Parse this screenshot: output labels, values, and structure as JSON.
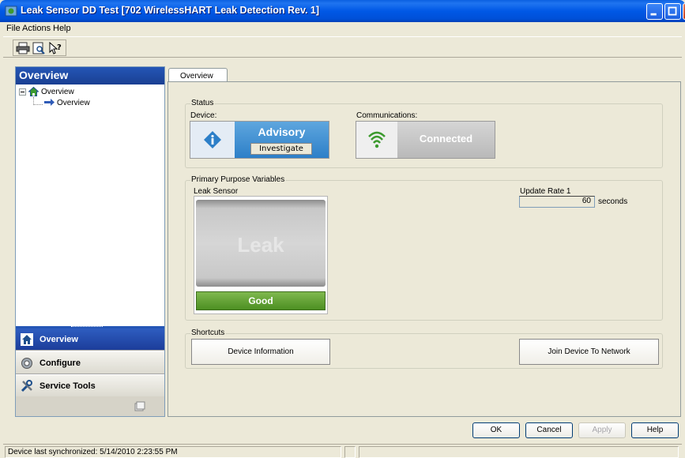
{
  "window": {
    "title": "Leak Sensor DD Test [702 WirelessHART Leak Detection Rev. 1]"
  },
  "menu": {
    "items": [
      {
        "label": "File",
        "accel": "F"
      },
      {
        "label": "Actions",
        "accel": "A"
      },
      {
        "label": "Help",
        "accel": "H"
      }
    ]
  },
  "toolbar": {
    "icons": [
      "print-icon",
      "print-preview-icon",
      "help-pointer-icon"
    ]
  },
  "left_panel": {
    "header": "Overview",
    "tree": {
      "root": "Overview",
      "child": "Overview"
    },
    "nav": [
      {
        "label": "Overview",
        "icon": "home-icon",
        "active": true
      },
      {
        "label": "Configure",
        "icon": "configure-icon",
        "active": false
      },
      {
        "label": "Service Tools",
        "icon": "tools-icon",
        "active": false
      }
    ]
  },
  "tab": {
    "label": "Overview"
  },
  "status": {
    "group_title": "Status",
    "device_label": "Device:",
    "device_state": "Advisory",
    "investigate_label": "Investigate",
    "comm_label": "Communications:",
    "comm_state": "Connected",
    "colors": {
      "advisory": "#2D7FC8",
      "connected_icon": "#3C9A2E"
    }
  },
  "ppv": {
    "group_title": "Primary Purpose Variables",
    "leak_label": "Leak Sensor",
    "leak_value": "Leak",
    "leak_status": "Good",
    "update_label": "Update Rate 1",
    "update_value": "60",
    "update_unit": "seconds"
  },
  "shortcuts": {
    "group_title": "Shortcuts",
    "device_info": "Device Information",
    "join_network": "Join Device To Network"
  },
  "dialog": {
    "ok": "OK",
    "cancel": "Cancel",
    "apply": "Apply",
    "help": "Help"
  },
  "statusbar": {
    "sync_text": "Device last synchronized: 5/14/2010 2:23:55 PM"
  }
}
